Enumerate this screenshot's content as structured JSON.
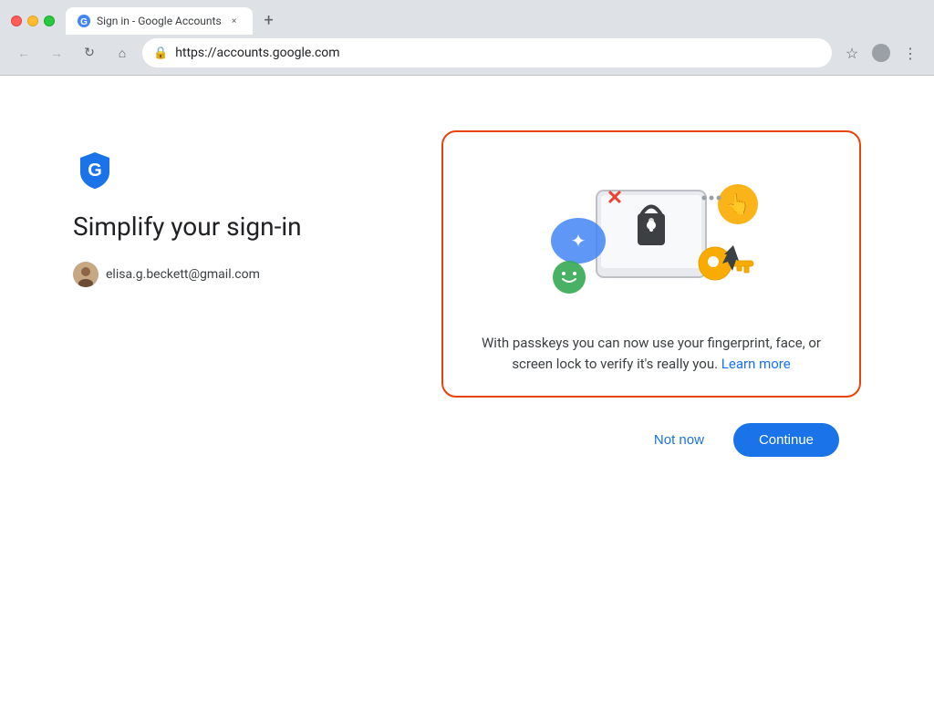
{
  "browser": {
    "tab_title": "Sign in - Google Accounts",
    "url": "https://accounts.google.com",
    "new_tab_label": "+",
    "close_label": "×"
  },
  "nav": {
    "back_icon": "←",
    "forward_icon": "→",
    "reload_icon": "↻",
    "home_icon": "⌂",
    "lock_icon": "🔒",
    "bookmark_icon": "☆",
    "menu_icon": "⋮"
  },
  "page": {
    "heading": "Simplify your sign-in",
    "email": "elisa.g.beckett@gmail.com",
    "card": {
      "description_part1": "With passkeys you can now use your fingerprint, face, or screen lock to verify it's really you.",
      "learn_more_label": "Learn more"
    },
    "buttons": {
      "not_now": "Not now",
      "continue": "Continue"
    }
  },
  "colors": {
    "card_border": "#e8430a",
    "primary_blue": "#1a73e8",
    "text_main": "#202124",
    "text_secondary": "#3c4043"
  }
}
